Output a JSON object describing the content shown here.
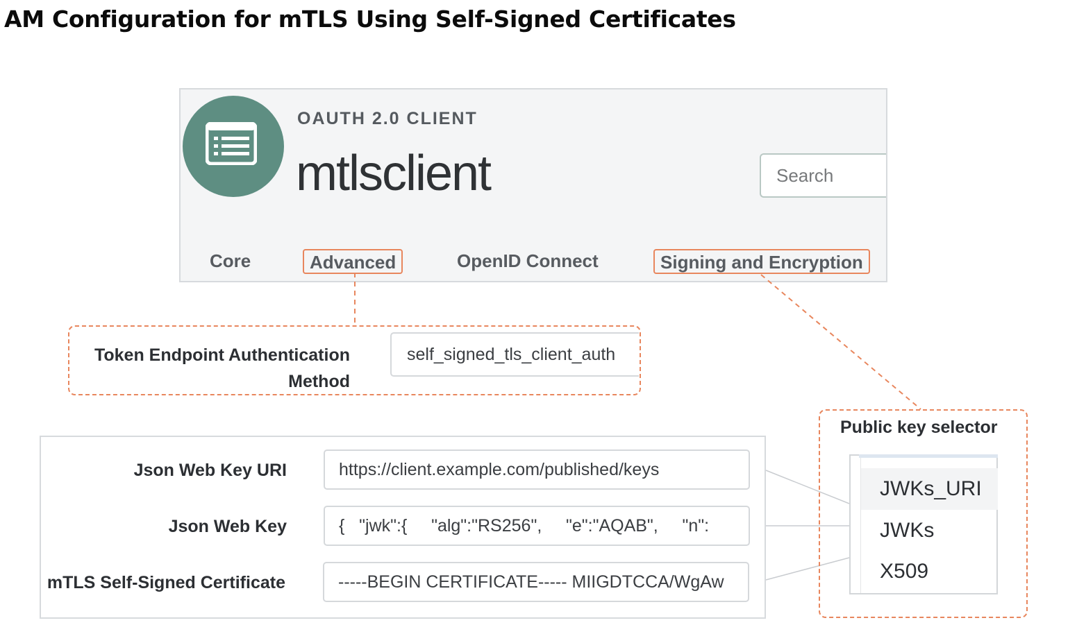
{
  "heading": "AM Configuration for mTLS Using Self-Signed Certificates",
  "client": {
    "kind_label": "OAUTH 2.0 CLIENT",
    "name": "mtlsclient",
    "search_placeholder": "Search",
    "avatar_icon": "list-icon",
    "avatar_color": "#5e8e82"
  },
  "tabs": [
    {
      "label": "Core",
      "highlighted": false
    },
    {
      "label": "Advanced",
      "highlighted": true
    },
    {
      "label": "OpenID Connect",
      "highlighted": false
    },
    {
      "label": "Signing and Encryption",
      "highlighted": true
    }
  ],
  "token_auth": {
    "label_line1": "Token Endpoint Authentication",
    "label_line2": "Method",
    "value": "self_signed_tls_client_auth"
  },
  "key_settings": [
    {
      "label": "Json Web Key URI",
      "value": "https://client.example.com/published/keys"
    },
    {
      "label": "Json Web Key",
      "value": "{   \"jwk\":{     \"alg\":\"RS256\",     \"e\":\"AQAB\",     \"n\":"
    },
    {
      "label": "mTLS Self-Signed Certificate",
      "value": "-----BEGIN CERTIFICATE----- MIIGDTCCA/WgAw"
    }
  ],
  "public_key_selector": {
    "title": "Public key selector",
    "options": [
      "JWKs_URI",
      "JWKs",
      "X509"
    ],
    "selected": "JWKs_URI"
  },
  "colors": {
    "highlight": "#e8865d",
    "connector": "#c9ccd0"
  }
}
